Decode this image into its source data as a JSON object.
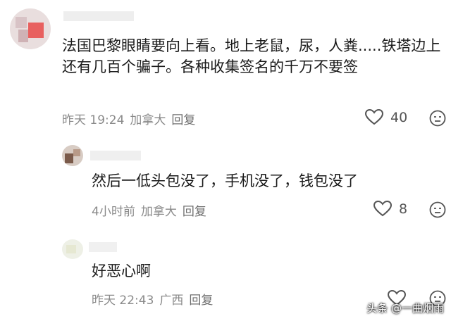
{
  "comments": [
    {
      "text": "法国巴黎眼睛要向上看。地上老鼠，尿，人粪.....铁塔边上还有几百个骗子。各种收集签名的千万不要签",
      "time": "昨天 19:24",
      "location": "加拿大",
      "reply_label": "回复",
      "likes": "40"
    },
    {
      "text": "然后一低头包没了，手机没了，钱包没了",
      "time": "4小时前",
      "location": "加拿大",
      "reply_label": "回复",
      "likes": "8"
    },
    {
      "text": "好恶心啊",
      "time": "昨天 22:43",
      "location": "广西",
      "reply_label": "回复",
      "likes": ""
    }
  ],
  "watermark": "头条 @一曲烟雨",
  "icons": {
    "like": "heart-outline-icon",
    "dislike": "frown-face-icon"
  },
  "colors": {
    "meta": "#8a8a8a",
    "text": "#1a1a1a"
  }
}
